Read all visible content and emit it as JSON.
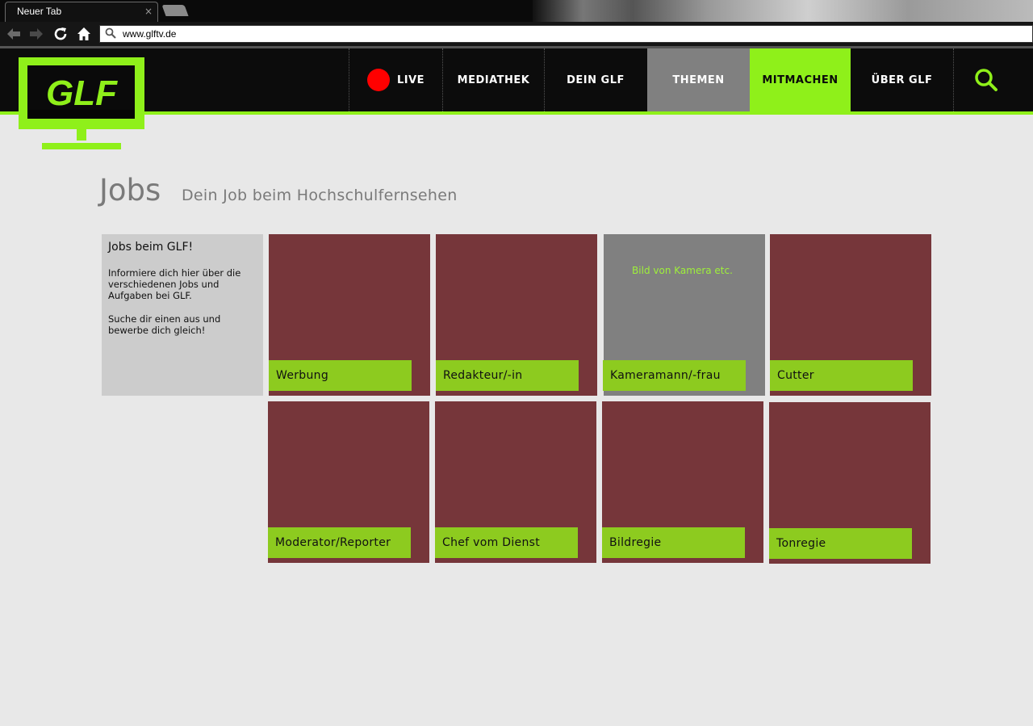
{
  "browser": {
    "tab_title": "Neuer Tab",
    "tab_close": "×",
    "url": "www.glftv.de"
  },
  "site": {
    "logo_text": "GLF",
    "nav": {
      "live": "LIVE",
      "mediathek": "MEDIATHEK",
      "dein_glf": "DEIN GLF",
      "themen": "THEMEN",
      "mitmachen": "MITMACHEN",
      "ueber_glf": "ÜBER GLF"
    },
    "colors": {
      "accent": "#8ff01a",
      "live_dot": "#ff0000",
      "tile": "#76363a",
      "label": "#8dcb1f"
    }
  },
  "page": {
    "title": "Jobs",
    "subtitle": "Dein Job beim Hochschulfernsehen"
  },
  "intro": {
    "heading": "Jobs beim GLF!",
    "paragraph1": "Informiere dich hier über die verschiedenen Jobs und Aufgaben bei GLF.",
    "paragraph2": "Suche dir einen aus und bewerbe dich gleich!"
  },
  "jobs": [
    {
      "label": "Werbung"
    },
    {
      "label": "Redakteur/-in"
    },
    {
      "label": "Kameramann/-frau",
      "placeholder_note": "Bild von Kamera etc."
    },
    {
      "label": "Cutter"
    },
    {
      "label": "Moderator/Reporter"
    },
    {
      "label": "Chef vom Dienst"
    },
    {
      "label": "Bildregie"
    },
    {
      "label": "Tonregie"
    }
  ]
}
